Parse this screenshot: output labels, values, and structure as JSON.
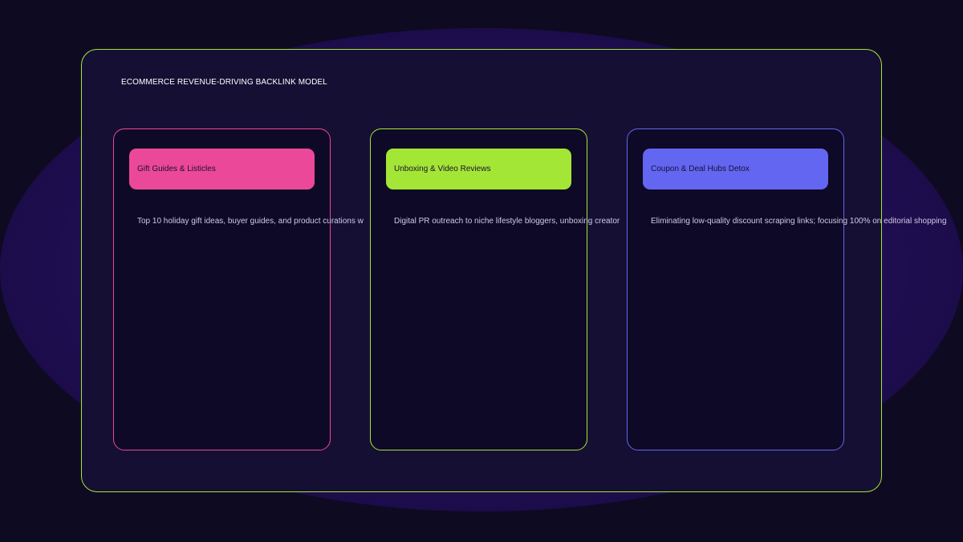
{
  "title": "ECOMMERCE REVENUE-DRIVING BACKLINK MODEL",
  "colors": {
    "background": "#0e0a22",
    "panel_border": "#a3e635",
    "pink": "#ec4899",
    "lime": "#a3e635",
    "indigo": "#6366f1"
  },
  "cards": [
    {
      "heading": "Gift Guides & Listicles",
      "body": "Top 10 holiday gift ideas, buyer guides, and product curations w",
      "accent": "#ec4899"
    },
    {
      "heading": "Unboxing & Video Reviews",
      "body": "Digital PR outreach to niche lifestyle bloggers, unboxing creator",
      "accent": "#a3e635"
    },
    {
      "heading": "Coupon & Deal Hubs Detox",
      "body": "Eliminating low-quality discount scraping links; focusing 100% on editorial shopping",
      "accent": "#6366f1"
    }
  ]
}
